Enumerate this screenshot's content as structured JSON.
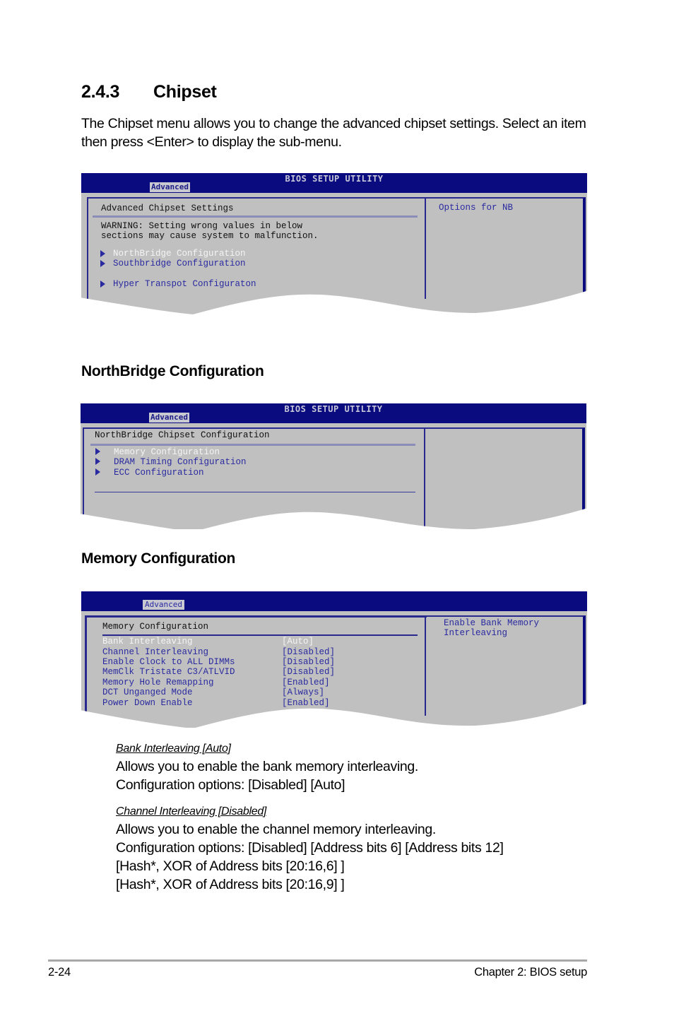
{
  "section": {
    "number": "2.4.3",
    "title": "Chipset",
    "intro": "The Chipset menu allows you to change the advanced chipset settings. Select an item then press <Enter> to display the sub-menu."
  },
  "bios_common": {
    "utility_title": "BIOS SETUP UTILITY",
    "active_tab": "Advanced"
  },
  "screen1": {
    "heading": "Advanced Chipset Settings",
    "warning_line1": "WARNING: Setting wrong values in below",
    "warning_line2": "sections may cause system to malfunction.",
    "items": [
      {
        "label": "NorthBridge Configuration",
        "selected": true
      },
      {
        "label": "Southbridge Configuration",
        "selected": false
      },
      {
        "label": "Hyper Transpot Configuraton",
        "selected": false
      }
    ],
    "help": "Options for NB"
  },
  "northbridge": {
    "subheading": "NorthBridge Configuration",
    "heading": "NorthBridge Chipset Configuration",
    "items": [
      {
        "label": "Memory Configuration",
        "selected": true
      },
      {
        "label": "DRAM Timing Configuration",
        "selected": false
      },
      {
        "label": "ECC Configuration",
        "selected": false
      }
    ],
    "help": ""
  },
  "memory": {
    "subheading": "Memory Configuration",
    "heading": "Memory Configuration",
    "settings": [
      {
        "label": "Bank Interleaving",
        "value": "[Auto]",
        "selected": true
      },
      {
        "label": "Channel Interleaving",
        "value": "[Disabled]",
        "selected": false
      },
      {
        "label": "Enable Clock to ALL DIMMs",
        "value": "[Disabled]",
        "selected": false
      },
      {
        "label": "MemClk Tristate C3/ATLVID",
        "value": "[Disabled]",
        "selected": false
      },
      {
        "label": "Memory Hole Remapping",
        "value": "[Enabled]",
        "selected": false
      },
      {
        "label": "DCT Unganged Mode",
        "value": "[Always]",
        "selected": false
      },
      {
        "label": "Power Down Enable",
        "value": "[Enabled]",
        "selected": false
      }
    ],
    "help_line1": "Enable Bank Memory",
    "help_line2": "Interleaving"
  },
  "options": [
    {
      "title": "Bank Interleaving [Auto]",
      "lines": [
        "Allows you to enable the bank memory interleaving.",
        "Configuration options: [Disabled] [Auto]"
      ]
    },
    {
      "title": "Channel Interleaving [Disabled]",
      "lines": [
        "Allows you to enable the channel memory interleaving.",
        "Configuration options: [Disabled] [Address bits 6] [Address bits 12]",
        "[Hash*, XOR of Address bits [20:16,6] ]",
        "[Hash*, XOR of Address bits [20:16,9] ]"
      ]
    }
  ],
  "footer": {
    "page": "2-24",
    "chapter": "Chapter 2: BIOS setup"
  },
  "colors": {
    "bios_bar": "#0b0b80",
    "bios_bg": "#c0c0c0",
    "bios_text_blue": "#2a2aa0",
    "bios_selected": "#f4f4f4"
  }
}
